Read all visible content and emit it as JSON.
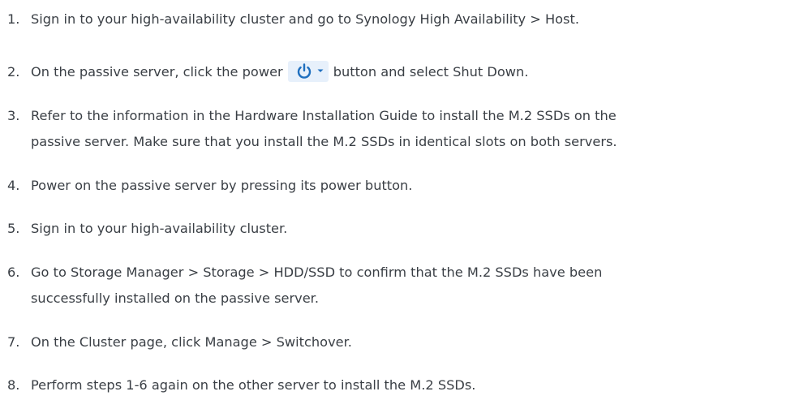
{
  "steps": [
    {
      "num": "1.",
      "text": "Sign in to your high-availability cluster and go to Synology High Availability > Host."
    },
    {
      "num": "2.",
      "before": "On the passive server, click the power",
      "after": "button and select Shut Down.",
      "icon": "power-icon",
      "icon_color": "#1f6fbf",
      "icon_bg": "#e7f0fb"
    },
    {
      "num": "3.",
      "text": "Refer to the information in the Hardware Installation Guide to install the M.2 SSDs on the",
      "text2": "passive server. Make sure that you install the M.2 SSDs in identical slots on both servers."
    },
    {
      "num": "4.",
      "text": "Power on the passive server by pressing its power button."
    },
    {
      "num": "5.",
      "text": "Sign in to your high-availability cluster."
    },
    {
      "num": "6.",
      "text": "Go to Storage Manager > Storage > HDD/SSD to confirm that the M.2 SSDs have been",
      "text2": "successfully installed on the passive server."
    },
    {
      "num": "7.",
      "text": "On the Cluster page, click Manage > Switchover."
    },
    {
      "num": "8.",
      "text": "Perform steps 1-6 again on the other server to install the M.2 SSDs."
    }
  ]
}
